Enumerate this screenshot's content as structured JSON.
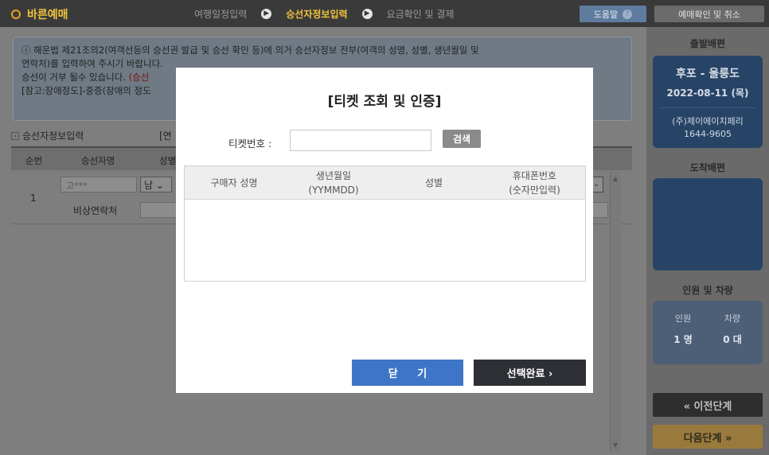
{
  "header": {
    "brand": "바른예매",
    "steps": [
      "여행일정입력",
      "승선자정보입력",
      "요금확인 및 결제"
    ],
    "help": "도움말",
    "confirm": "예매확인 및 취소"
  },
  "notice": {
    "line1": "해운법 제21조의2(여객선등의 승선권 발급 및 승선 확인 등)에 의거 승선자정보 전부(여객의 성명, 성별, 생년월일 및",
    "line2": "연락처)를 입력하여 주시기 바랍니다.",
    "line3_pre": "승선이 거부 될수 있습니다.",
    "line3_red": "(승선",
    "line4": "[참고:장애정도]-중증(장애의 정도"
  },
  "section": {
    "title": "승선자정보입력",
    "link": "[연"
  },
  "passenger_table": {
    "headers": [
      "순번",
      "승선자명",
      "성별"
    ],
    "rows": [
      {
        "num": "1",
        "name": "고***",
        "gender": "남",
        "emergency_label": "비상연락처"
      }
    ]
  },
  "sidebar": {
    "departure_title": "출발배편",
    "route": "후포 - 울릉도",
    "date": "2022-08-11 (목)",
    "company": "(주)제이에이치페리",
    "phone": "1644-9605",
    "arrival_title": "도착배편",
    "people_title": "인원 및 차량",
    "people_label": "인원",
    "people_value": "1 명",
    "vehicle_label": "차량",
    "vehicle_value": "0 대",
    "prev": "« 이전단계",
    "next": "다음단계 »"
  },
  "modal": {
    "title": "[티켓 조회 및 인증]",
    "ticket_label": "티켓번호 :",
    "ticket_value": "",
    "search": "검색",
    "columns": [
      {
        "line1": "구매자 성명",
        "line2": ""
      },
      {
        "line1": "생년월일",
        "line2": "(YYMMDD)"
      },
      {
        "line1": "성별",
        "line2": ""
      },
      {
        "line1": "휴대폰번호",
        "line2": "(숫자만입력)"
      }
    ],
    "close": "닫 기",
    "done": "선택완료 ›"
  }
}
